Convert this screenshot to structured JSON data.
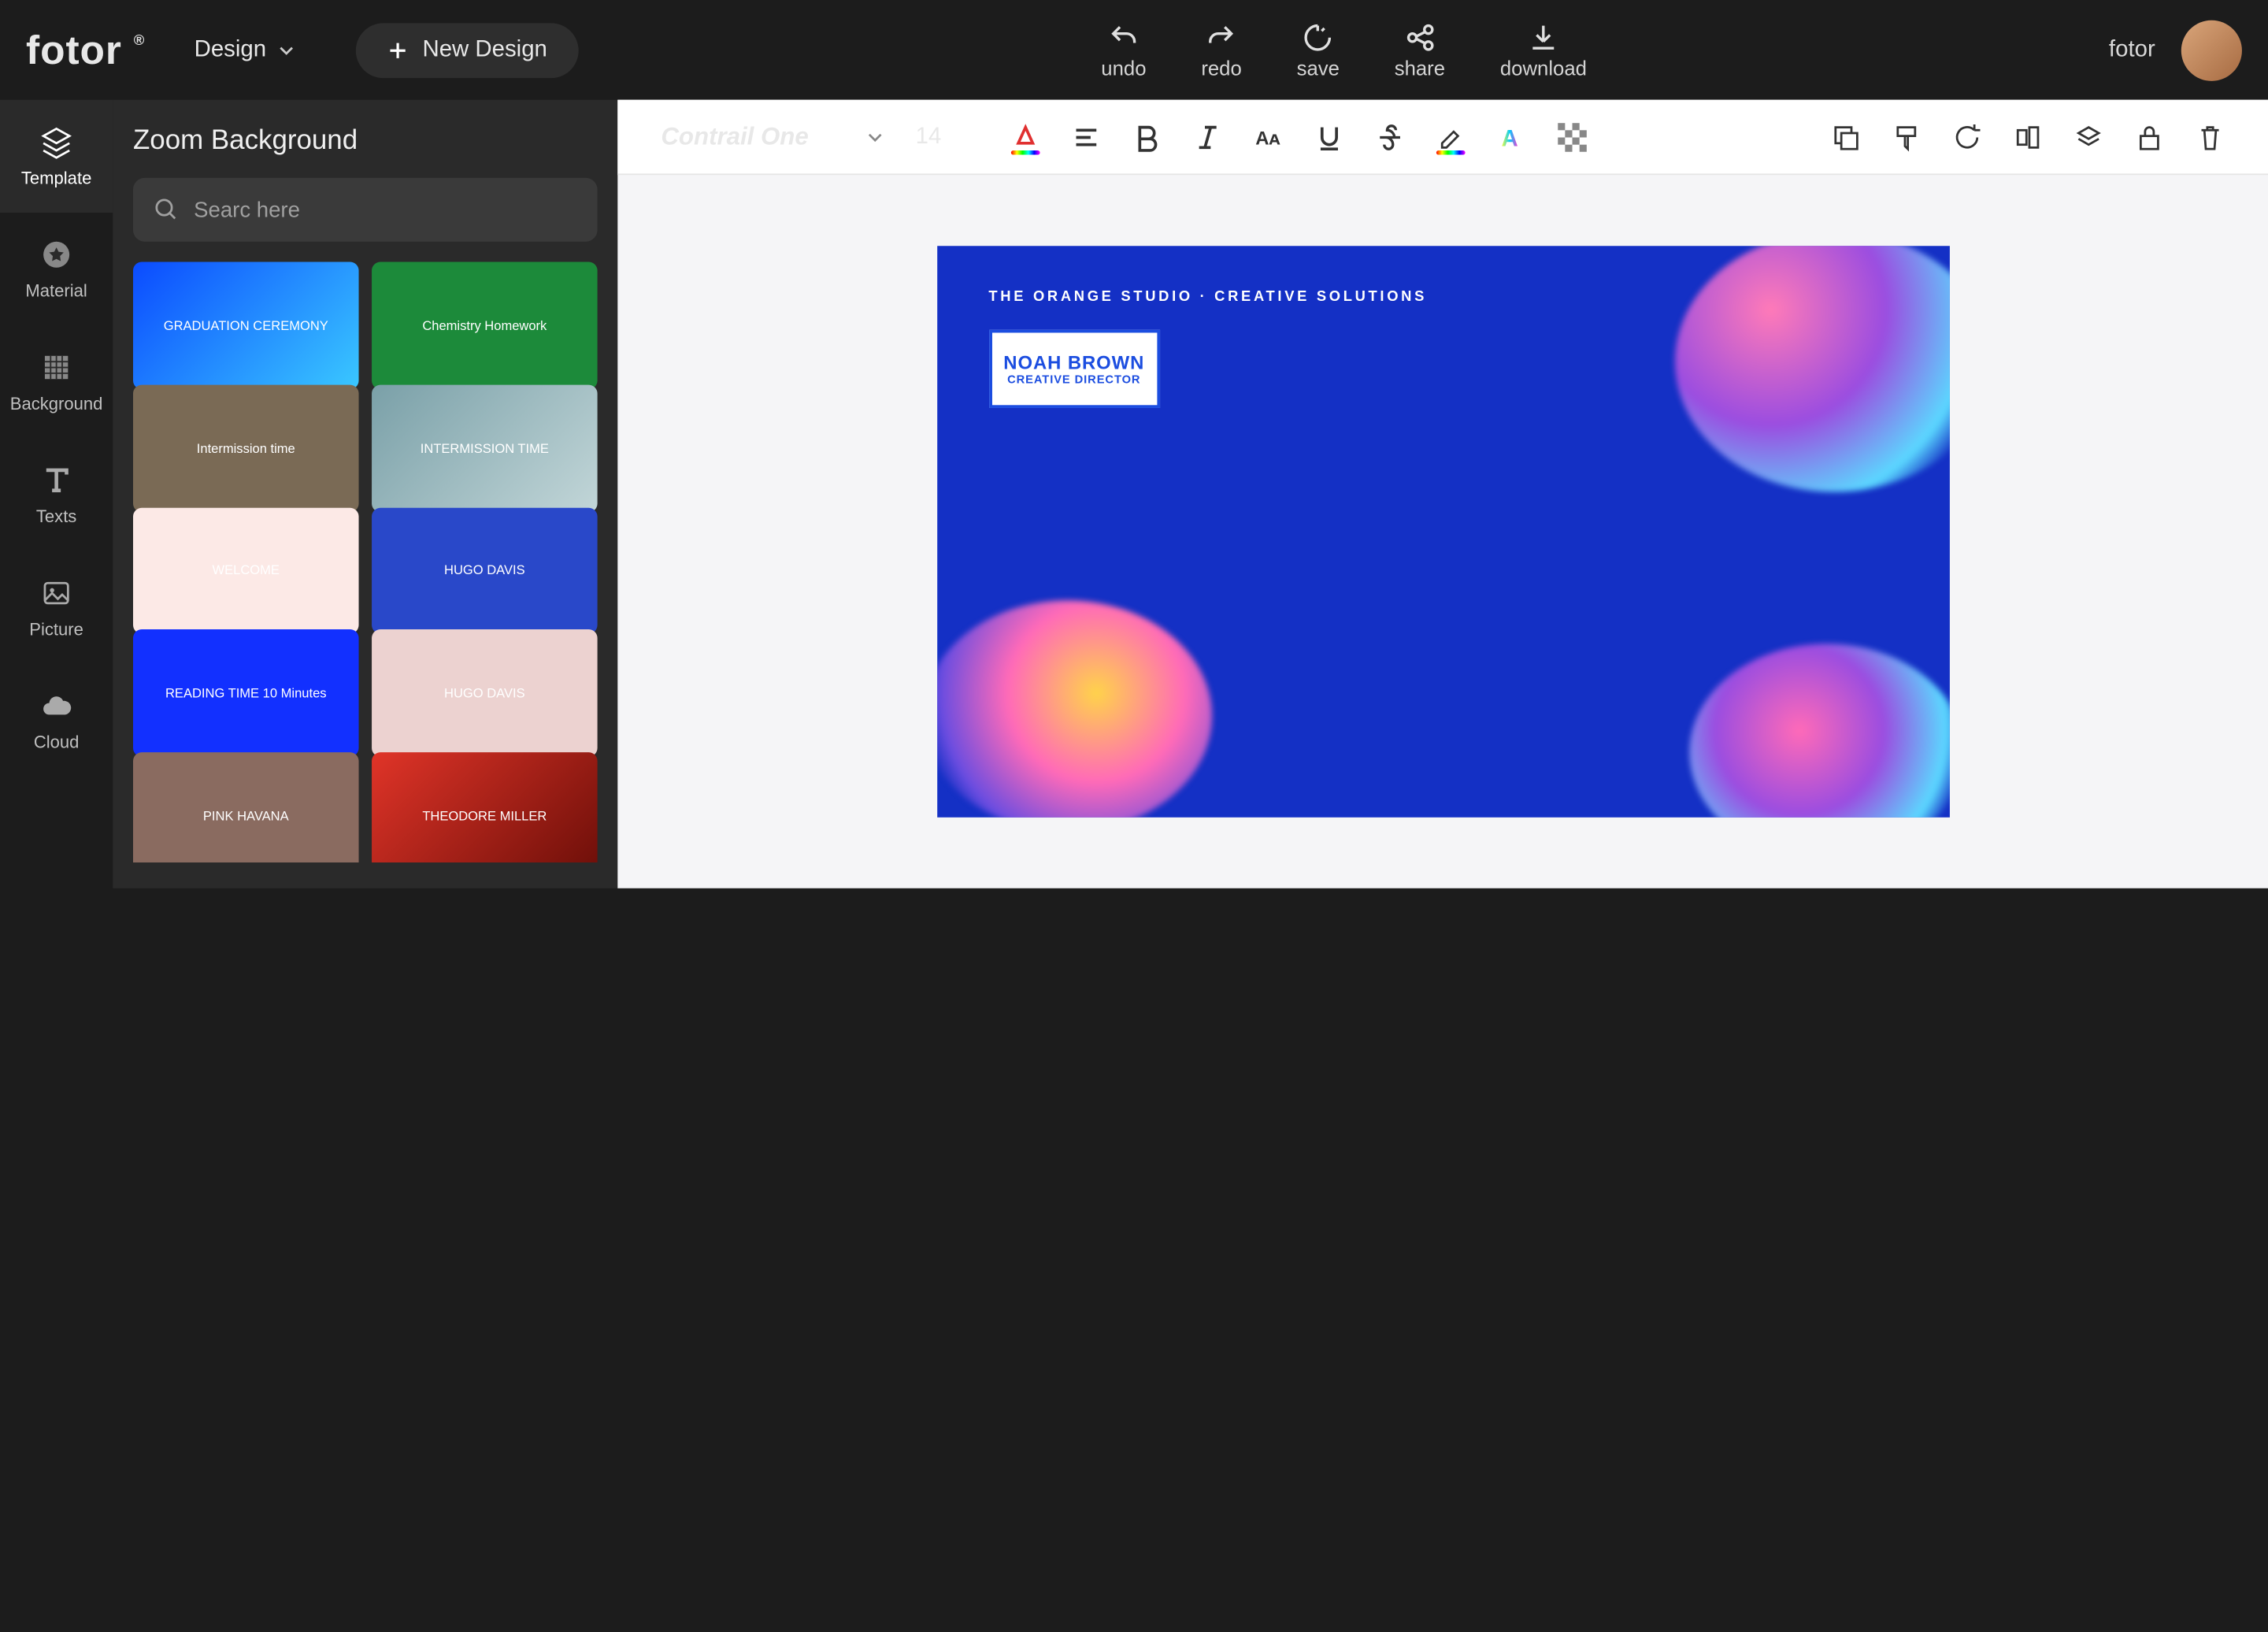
{
  "header": {
    "logo": "fotor",
    "design_label": "Design",
    "new_design_label": "New Design",
    "actions": {
      "undo": "undo",
      "redo": "redo",
      "save": "save",
      "share": "share",
      "download": "download"
    },
    "brand": "fotor"
  },
  "rail": {
    "template": "Template",
    "material": "Material",
    "background": "Background",
    "texts": "Texts",
    "picture": "Picture",
    "cloud": "Cloud"
  },
  "panel": {
    "title": "Zoom Background",
    "search_placeholder": "Searc here",
    "thumbs": [
      {
        "label": "GRADUATION CEREMONY",
        "bg": "linear-gradient(135deg,#0b4bff,#3ac8ff)"
      },
      {
        "label": "Chemistry Homework",
        "bg": "#1c8a3a"
      },
      {
        "label": "Intermission time",
        "bg": "#7a6a55"
      },
      {
        "label": "INTERMISSION TIME",
        "bg": "linear-gradient(135deg,#7aa0a8,#c2d6d8)"
      },
      {
        "label": "WELCOME",
        "bg": "#fce9e6"
      },
      {
        "label": "HUGO DAVIS",
        "bg": "#2948c9"
      },
      {
        "label": "READING TIME 10 Minutes",
        "bg": "#1230ff"
      },
      {
        "label": "HUGO DAVIS",
        "bg": "#ecd2d0"
      },
      {
        "label": "PINK HAVANA",
        "bg": "#8a6b60"
      },
      {
        "label": "THEODORE MILLER",
        "bg": "linear-gradient(135deg,#e03428,#6b0e08)"
      }
    ]
  },
  "toolbar": {
    "font": "Contrail One",
    "size": "14"
  },
  "canvas": {
    "tagline": "THE ORANGE STUDIO · CREATIVE SOLUTIONS",
    "name": "NOAH BROWN",
    "role": "CREATIVE DIRECTOR"
  }
}
